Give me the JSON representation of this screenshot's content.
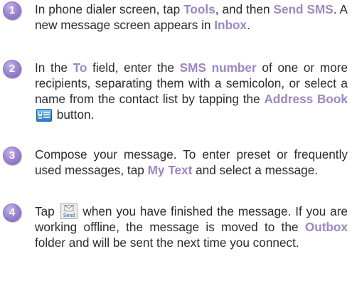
{
  "steps": [
    {
      "number": "1",
      "parts": {
        "p1": "In phone dialer screen, tap ",
        "h1": "Tools",
        "p2": ", and then ",
        "h2": "Send SMS",
        "p3": ". A new message screen appears in ",
        "h3": "Inbox",
        "p4": "."
      }
    },
    {
      "number": "2",
      "parts": {
        "p1": "In the ",
        "h1": "To",
        "p2": " field, enter the ",
        "h2": "SMS number",
        "p3": " of one or more recipients, separating them with a semicolon, or select a name from the contact list by tapping the ",
        "h3": "Address Book",
        "p4": " button."
      }
    },
    {
      "number": "3",
      "parts": {
        "p1": "Compose your message. To enter preset or frequently  used messages, tap ",
        "h1": "My Text",
        "p2": " and select a message."
      }
    },
    {
      "number": "4",
      "parts": {
        "p1": "Tap ",
        "icon_label": "Send",
        "p2": " when you have finished the message. If you are working offline, the message is moved to the ",
        "h1": "Outbox",
        "p3": " folder and will be sent the next time you connect."
      }
    }
  ],
  "colors": {
    "highlight": "#9b86c9",
    "badge": "#9c86cf",
    "text": "#2b2b2b"
  },
  "icons": {
    "address_book": "address-book-icon",
    "send": "send-icon"
  }
}
